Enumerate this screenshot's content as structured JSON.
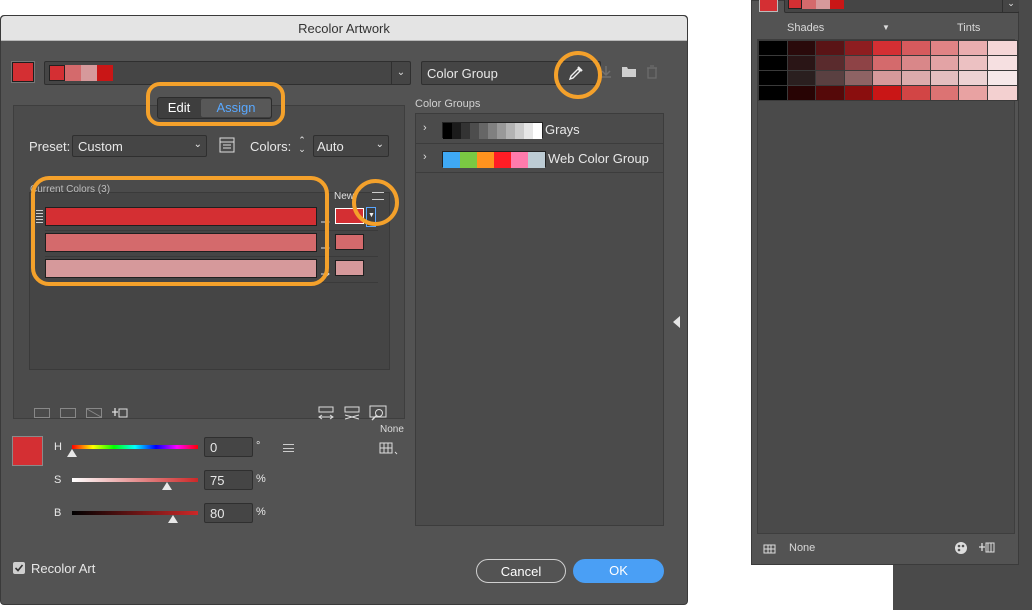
{
  "dialog": {
    "title": "Recolor Artwork",
    "group_name": "Color Group",
    "tabs": [
      {
        "label": "Edit"
      },
      {
        "label": "Assign"
      }
    ],
    "preset_label": "Preset:",
    "preset_value": "Custom",
    "colors_label": "Colors:",
    "colors_value": "Auto",
    "current_colors_label": "Current Colors (3)",
    "new_label": "New",
    "current_colors": [
      "#d42f33",
      "#d46a6c",
      "#d6999b"
    ],
    "new_colors": [
      "#d42f33",
      "#d46a6c",
      "#d6999b"
    ],
    "swatch_strip": [
      "#d42f33",
      "#d46a6c",
      "#d6999b",
      "#c91616"
    ],
    "main_swatch": "#d42f33",
    "sliders": [
      {
        "label": "H",
        "value": "0",
        "unit": "°"
      },
      {
        "label": "S",
        "value": "75",
        "unit": "%"
      },
      {
        "label": "B",
        "value": "80",
        "unit": "%"
      }
    ],
    "none_label": "None",
    "color_groups_label": "Color Groups",
    "color_groups": [
      {
        "name": "Grays",
        "swatches": [
          "#000000",
          "#1b1b1b",
          "#333333",
          "#4d4d4d",
          "#666666",
          "#808080",
          "#999999",
          "#b3b3b3",
          "#cccccc",
          "#e6e6e6",
          "#ffffff"
        ]
      },
      {
        "name": "Web Color Group",
        "swatches": [
          "#3fa9f5",
          "#7ac943",
          "#ff931e",
          "#ff1d25",
          "#ff7bac",
          "#bdccd4"
        ]
      }
    ],
    "recolor_art_label": "Recolor Art",
    "recolor_art_checked": true,
    "cancel_label": "Cancel",
    "ok_label": "OK",
    "accent_color": "#4a9ff5",
    "highlight_color": "#f4a12b"
  },
  "side_panel": {
    "shades_label": "Shades",
    "tints_label": "Tints",
    "none_label": "None",
    "top_swatches": [
      "#d42f33",
      "#d46a6c",
      "#d6999b",
      "#c91616"
    ],
    "grid": [
      [
        "#000000",
        "#2a0a0b",
        "#5a1416",
        "#8e1d20",
        "#d42f33",
        "#d65a5d",
        "#e08385",
        "#eaadaf",
        "#f5d6d7"
      ],
      [
        "#000000",
        "#2a1516",
        "#5a2b2d",
        "#8e4346",
        "#d46a6c",
        "#d98789",
        "#e3a3a5",
        "#ecc1c2",
        "#f6e0e1"
      ],
      [
        "#000000",
        "#2a1f1f",
        "#5a4041",
        "#8e6364",
        "#d6999b",
        "#dcabac",
        "#e4bebf",
        "#edd2d3",
        "#f6e8e9"
      ],
      [
        "#000000",
        "#280404",
        "#550909",
        "#8a0e0e",
        "#c91616",
        "#d24545",
        "#dc7373",
        "#e8a2a2",
        "#f3d0d0"
      ]
    ]
  }
}
